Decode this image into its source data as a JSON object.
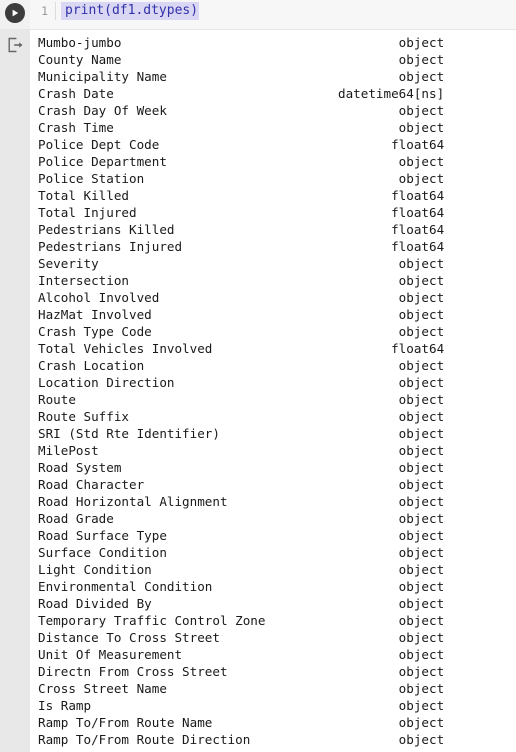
{
  "cell": {
    "run_button_label": "Run cell",
    "line_number": "1",
    "code": "print(df1.dtypes)",
    "code_color": "#3232a8",
    "code_highlight_color": "#d9d7f3",
    "run_icon": "play-icon"
  },
  "output": {
    "icon": "output-export-icon",
    "columns": [
      "name",
      "dtype"
    ],
    "rows": [
      {
        "name": "Mumbo-jumbo",
        "dtype": "object"
      },
      {
        "name": "County Name",
        "dtype": "object"
      },
      {
        "name": "Municipality Name",
        "dtype": "object"
      },
      {
        "name": "Crash Date",
        "dtype": "datetime64[ns]"
      },
      {
        "name": "Crash Day Of Week",
        "dtype": "object"
      },
      {
        "name": "Crash Time",
        "dtype": "object"
      },
      {
        "name": "Police Dept Code",
        "dtype": "float64"
      },
      {
        "name": "Police Department",
        "dtype": "object"
      },
      {
        "name": "Police Station",
        "dtype": "object"
      },
      {
        "name": "Total Killed",
        "dtype": "float64"
      },
      {
        "name": "Total Injured",
        "dtype": "float64"
      },
      {
        "name": "Pedestrians Killed",
        "dtype": "float64"
      },
      {
        "name": "Pedestrians Injured",
        "dtype": "float64"
      },
      {
        "name": "Severity",
        "dtype": "object"
      },
      {
        "name": "Intersection",
        "dtype": "object"
      },
      {
        "name": "Alcohol Involved",
        "dtype": "object"
      },
      {
        "name": "HazMat Involved",
        "dtype": "object"
      },
      {
        "name": "Crash Type Code",
        "dtype": "object"
      },
      {
        "name": "Total Vehicles Involved",
        "dtype": "float64"
      },
      {
        "name": "Crash Location",
        "dtype": "object"
      },
      {
        "name": "Location Direction",
        "dtype": "object"
      },
      {
        "name": "Route",
        "dtype": "object"
      },
      {
        "name": "Route Suffix",
        "dtype": "object"
      },
      {
        "name": "SRI (Std Rte Identifier)",
        "dtype": "object"
      },
      {
        "name": "MilePost",
        "dtype": "object"
      },
      {
        "name": "Road System",
        "dtype": "object"
      },
      {
        "name": "Road Character",
        "dtype": "object"
      },
      {
        "name": "Road Horizontal Alignment",
        "dtype": "object"
      },
      {
        "name": "Road Grade",
        "dtype": "object"
      },
      {
        "name": "Road Surface Type",
        "dtype": "object"
      },
      {
        "name": "Surface Condition",
        "dtype": "object"
      },
      {
        "name": "Light Condition",
        "dtype": "object"
      },
      {
        "name": "Environmental Condition",
        "dtype": "object"
      },
      {
        "name": "Road Divided By",
        "dtype": "object"
      },
      {
        "name": "Temporary Traffic Control Zone",
        "dtype": "object"
      },
      {
        "name": "Distance To Cross Street",
        "dtype": "object"
      },
      {
        "name": "Unit Of Measurement",
        "dtype": "object"
      },
      {
        "name": "Directn From Cross Street",
        "dtype": "object"
      },
      {
        "name": "Cross Street Name",
        "dtype": "object"
      },
      {
        "name": "Is Ramp",
        "dtype": "object"
      },
      {
        "name": "Ramp To/From Route Name",
        "dtype": "object"
      },
      {
        "name": "Ramp To/From Route Direction",
        "dtype": "object"
      }
    ]
  }
}
